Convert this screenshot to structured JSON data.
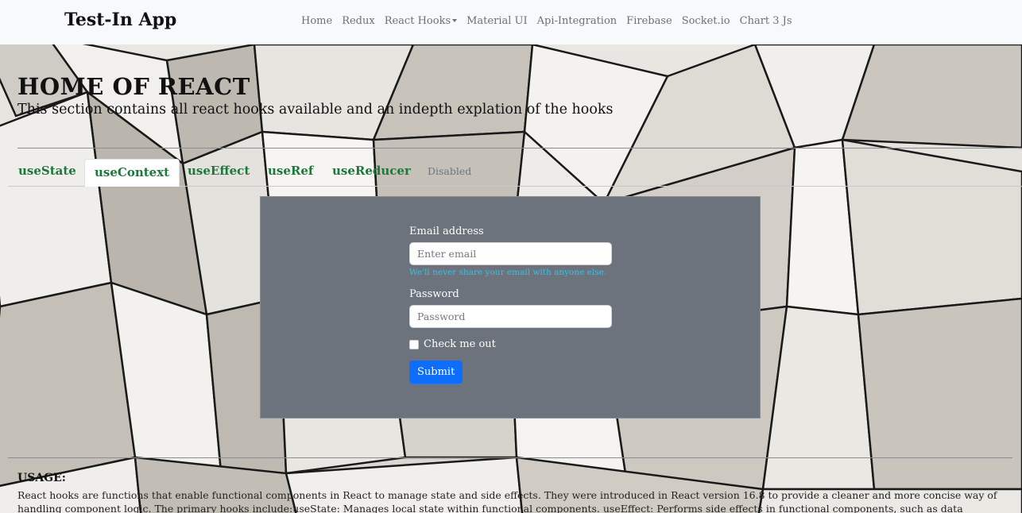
{
  "navbar": {
    "brand": "Test-In App",
    "links": [
      "Home",
      "Redux",
      "React Hooks",
      "Material UI",
      "Api-Integration",
      "Firebase",
      "Socket.io",
      "Chart 3 Js"
    ]
  },
  "page": {
    "title": "HOME OF REACT",
    "subtitle": "This section contains all react hooks available and an indepth explation of the hooks"
  },
  "tabs": {
    "items": [
      "useState",
      "useContext",
      "useEffect",
      "useRef",
      "useReducer",
      "Disabled"
    ],
    "active": "useContext"
  },
  "form": {
    "email_label": "Email address",
    "email_placeholder": "Enter email",
    "email_help": "We'll never share your email with anyone else.",
    "password_label": "Password",
    "password_placeholder": "Password",
    "checkbox_label": "Check me out",
    "submit_label": "Submit"
  },
  "usage": {
    "title": "USAGE:",
    "text": "React hooks are functions that enable functional components in React to manage state and side effects. They were introduced in React version 16.8 to provide a cleaner and more concise way of handling component logic. The primary hooks include:useState: Manages local state within functional components. useEffect: Performs side effects in functional components, such as data fetching"
  },
  "colors": {
    "navbar_bg": "#f8f9fa",
    "panel_bg": "#6c737d",
    "tab_text": "#1a7a3a",
    "submit_bg": "#0d6efd",
    "help_text": "#33c2e6"
  }
}
